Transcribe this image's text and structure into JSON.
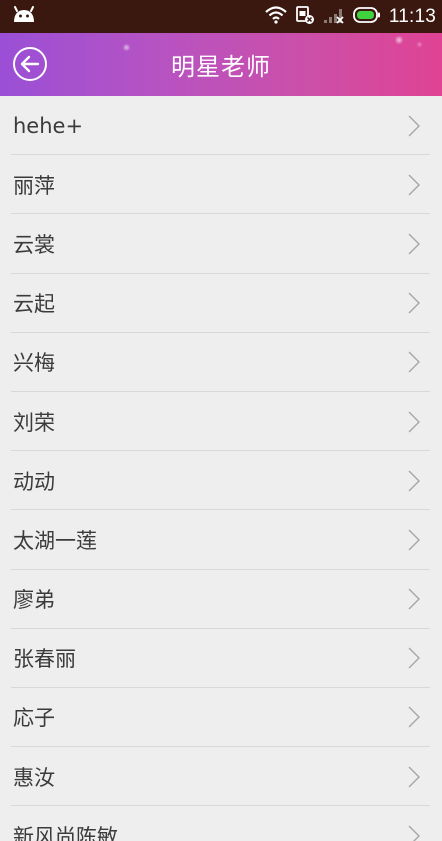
{
  "status_bar": {
    "time": "11:13",
    "icons": [
      "android-icon",
      "wifi-icon",
      "sim-card-icon",
      "signal-icon",
      "battery-icon"
    ]
  },
  "header": {
    "title": "明星老师",
    "back_icon": "back-arrow-icon"
  },
  "colors": {
    "header_gradient_start": "#9a4fd6",
    "header_gradient_end": "#e04393",
    "background": "#efeeef",
    "divider": "#d9d7d9",
    "text": "#3b3b3b"
  },
  "list": {
    "items": [
      {
        "label": "hehe+"
      },
      {
        "label": "丽萍"
      },
      {
        "label": "云裳"
      },
      {
        "label": "云起"
      },
      {
        "label": "兴梅"
      },
      {
        "label": "刘荣"
      },
      {
        "label": "动动"
      },
      {
        "label": "太湖一莲"
      },
      {
        "label": "廖弟"
      },
      {
        "label": "张春丽"
      },
      {
        "label": "応子"
      },
      {
        "label": "惠汝"
      },
      {
        "label": "新风尚陈敏"
      }
    ]
  }
}
